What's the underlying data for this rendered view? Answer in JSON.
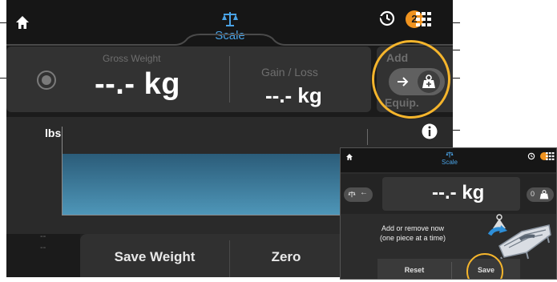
{
  "header": {
    "title": "Scale",
    "badge_count": "2",
    "icons": [
      "home-icon",
      "scale-icon",
      "history-icon",
      "grid-menu-icon"
    ]
  },
  "weight_panel": {
    "gross_label": "Gross Weight",
    "gross_value": "--.- kg",
    "gain_label": "Gain / Loss",
    "gain_value": "--.- kg"
  },
  "add_equipment": {
    "label_top": "Add",
    "label_bottom": "Equip."
  },
  "chart": {
    "unit_label": "lbs",
    "dash_top": "--",
    "dash_bottom": "--"
  },
  "actions": {
    "save_weight": "Save Weight",
    "zero": "Zero"
  },
  "inset": {
    "title": "Scale",
    "weight": "--.- kg",
    "right_toggle_value": "0",
    "message_line1": "Add or remove now",
    "message_line2": "(one piece at a time)",
    "reset": "Reset",
    "save": "Save"
  },
  "colors": {
    "accent_blue": "#4aa3e6",
    "badge_orange": "#f0931f",
    "highlight_yellow": "#f5b52c",
    "background_dark": "#1b1b1b"
  }
}
